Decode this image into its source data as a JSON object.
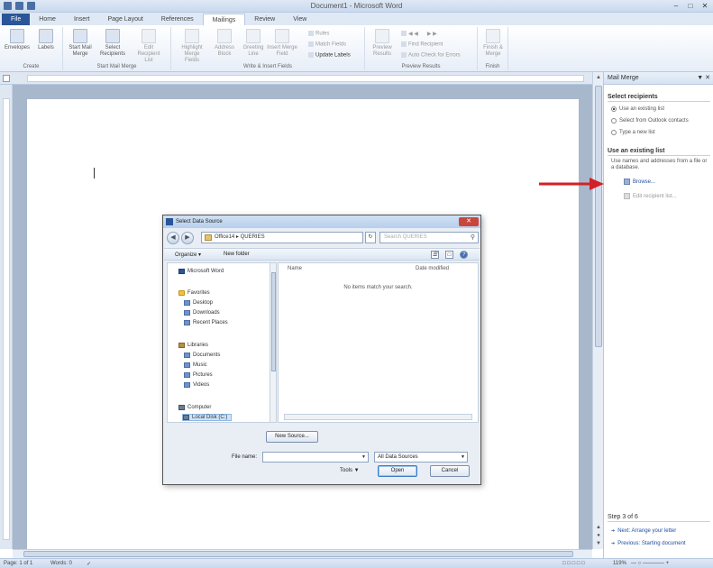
{
  "window": {
    "title": "Document1 - Microsoft Word"
  },
  "tabs": [
    "File",
    "Home",
    "Insert",
    "Page Layout",
    "References",
    "Mailings",
    "Review",
    "View"
  ],
  "ribbon": {
    "create": {
      "label": "Create",
      "envelopes": "Envelopes",
      "labels": "Labels"
    },
    "start": {
      "label": "Start Mail Merge",
      "start_merge": "Start Mail Merge",
      "select_recipients": "Select Recipients",
      "edit_list": "Edit Recipient List"
    },
    "write": {
      "label": "Write & Insert Fields",
      "highlight": "Highlight Merge Fields",
      "address": "Address Block",
      "greeting": "Greeting Line",
      "insert_field": "Insert Merge Field",
      "rules": "Rules",
      "match": "Match Fields",
      "update": "Update Labels"
    },
    "preview": {
      "label": "Preview Results",
      "preview": "Preview Results",
      "find": "Find Recipient",
      "auto_check": "Auto Check for Errors"
    },
    "finish": {
      "label": "Finish",
      "finish_merge": "Finish & Merge"
    }
  },
  "status": {
    "page": "Page: 1 of 1",
    "words": "Words: 0",
    "zoom": "119%"
  },
  "pane": {
    "title": "Mail Merge",
    "select_heading": "Select recipients",
    "options": [
      "Use an existing list",
      "Select from Outlook contacts",
      "Type a new list"
    ],
    "existing_heading": "Use an existing list",
    "existing_desc": "Use names and addresses from a file or a database.",
    "browse": "Browse...",
    "edit_list": "Edit recipient list...",
    "step": "Step 3 of 6",
    "next": "Next: Arrange your letter",
    "previous": "Previous: Starting document"
  },
  "dialog": {
    "title": "Select Data Source",
    "path": "Office14 ▸ QUERIES",
    "search_placeholder": "Search QUERIES",
    "organize": "Organize ▾",
    "new_folder": "New folder",
    "nav": {
      "word": "Microsoft Word",
      "favorites": "Favorites",
      "desktop": "Desktop",
      "downloads": "Downloads",
      "recent": "Recent Places",
      "libraries": "Libraries",
      "documents": "Documents",
      "music": "Music",
      "pictures": "Pictures",
      "videos": "Videos",
      "computer": "Computer",
      "local_disk": "Local Disk (C:)"
    },
    "columns": {
      "name": "Name",
      "date": "Date modified"
    },
    "empty_text": "No items match your search.",
    "new_source": "New Source...",
    "filename_label": "File name:",
    "filetype": "All Data Sources",
    "tools": "Tools",
    "open": "Open",
    "cancel": "Cancel"
  },
  "colors": {
    "accent": "#2a5699",
    "arrow": "#d32027",
    "link": "#1f4fa3"
  }
}
